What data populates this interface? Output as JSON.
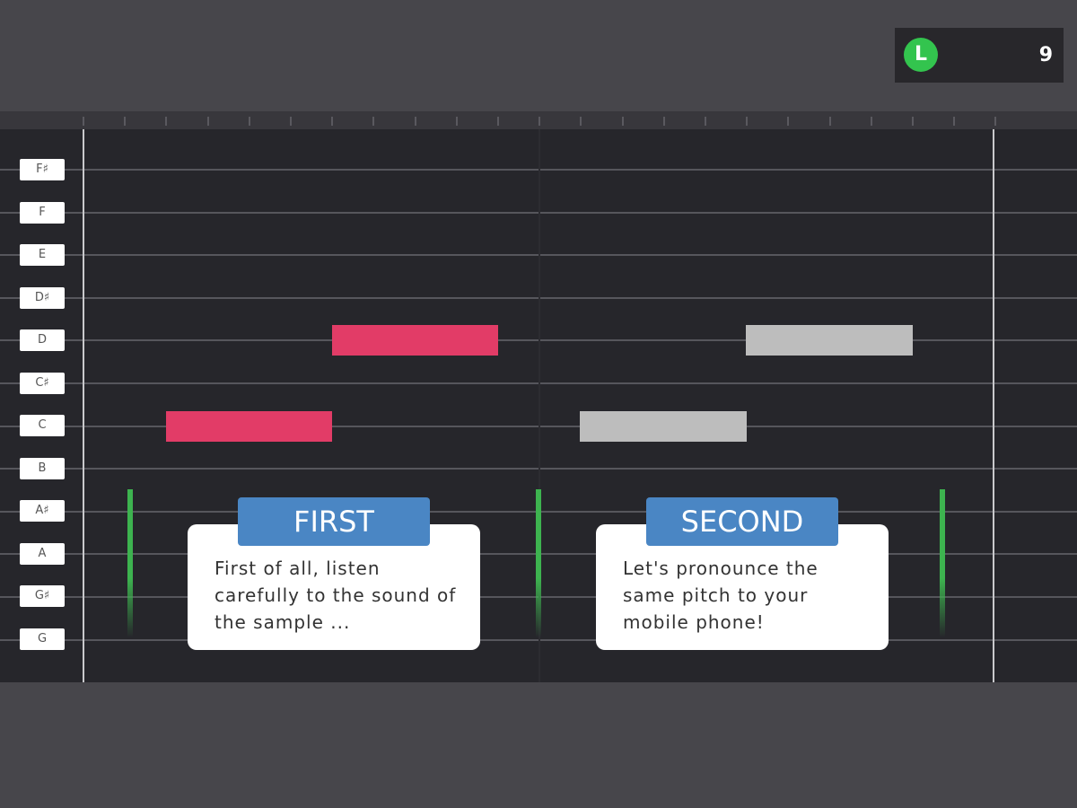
{
  "level": {
    "badge": "L",
    "score": "9"
  },
  "keys": [
    "F♯",
    "F",
    "E",
    "D♯",
    "D",
    "C♯",
    "C",
    "B",
    "A♯",
    "A",
    "G♯",
    "G"
  ],
  "colors": {
    "sample_note": "#e23c67",
    "target_note": "#bdbdbd",
    "marker": "#3db34f",
    "tab": "#4a86c4"
  },
  "notes": {
    "sample": [
      {
        "pitch": "C"
      },
      {
        "pitch": "D"
      }
    ],
    "target": [
      {
        "pitch": "C"
      },
      {
        "pitch": "D"
      }
    ]
  },
  "steps": {
    "first": {
      "title": "FIRST",
      "text": "First of all, listen carefully to the sound of the sample ..."
    },
    "second": {
      "title": "SECOND",
      "text": "Let's pronounce the same pitch to your mobile phone!"
    }
  }
}
